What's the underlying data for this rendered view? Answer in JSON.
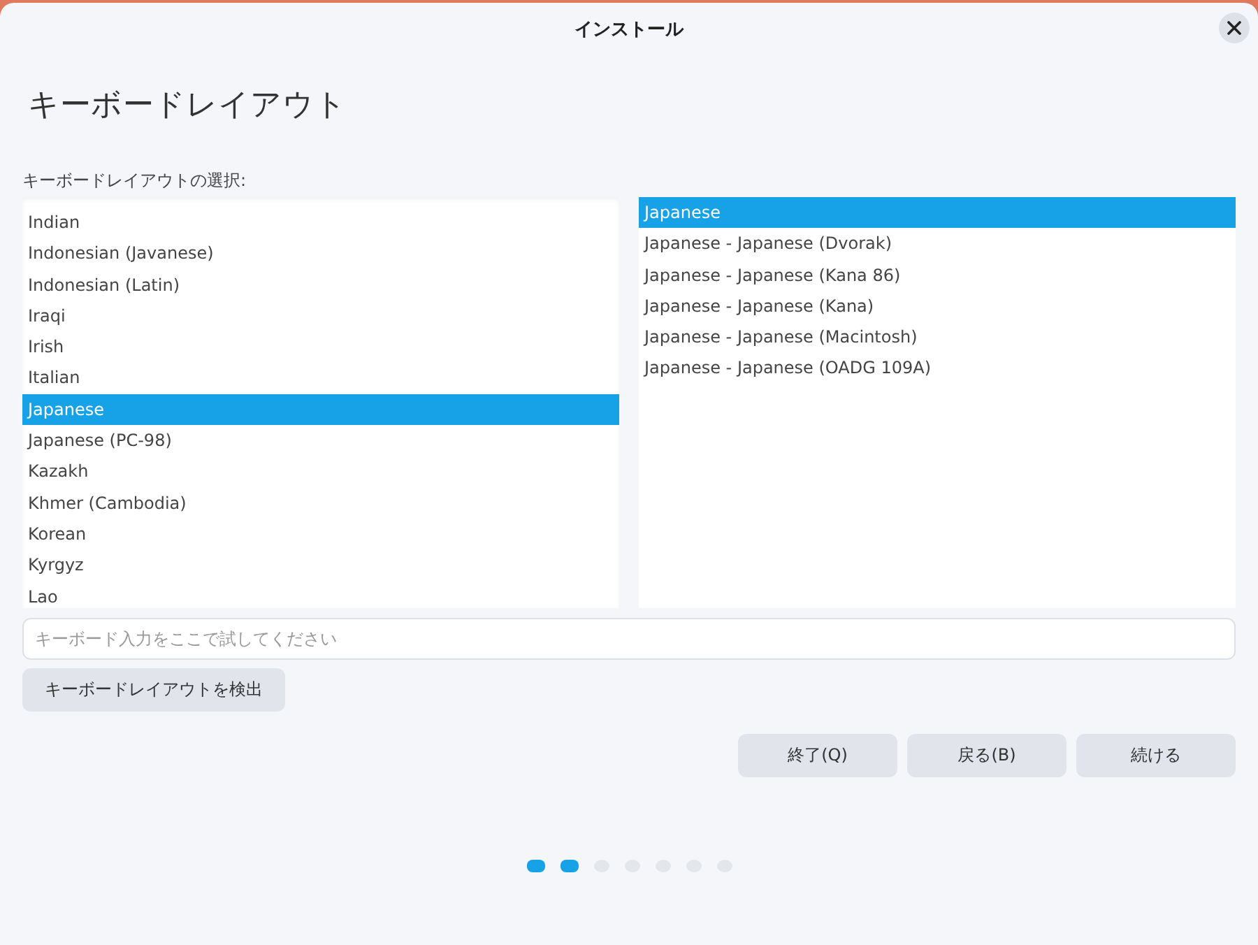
{
  "window": {
    "title": "インストール"
  },
  "heading": "キーボードレイアウト",
  "layout_label": "キーボードレイアウトの選択:",
  "layouts": [
    {
      "label": "Indian",
      "selected": false
    },
    {
      "label": "Indonesian (Javanese)",
      "selected": false
    },
    {
      "label": "Indonesian (Latin)",
      "selected": false
    },
    {
      "label": "Iraqi",
      "selected": false
    },
    {
      "label": "Irish",
      "selected": false
    },
    {
      "label": "Italian",
      "selected": false
    },
    {
      "label": "Japanese",
      "selected": true
    },
    {
      "label": "Japanese (PC-98)",
      "selected": false
    },
    {
      "label": "Kazakh",
      "selected": false
    },
    {
      "label": "Khmer (Cambodia)",
      "selected": false
    },
    {
      "label": "Korean",
      "selected": false
    },
    {
      "label": "Kyrgyz",
      "selected": false
    },
    {
      "label": "Lao",
      "selected": false
    }
  ],
  "variants": [
    {
      "label": "Japanese",
      "selected": true
    },
    {
      "label": "Japanese - Japanese (Dvorak)",
      "selected": false
    },
    {
      "label": "Japanese - Japanese (Kana 86)",
      "selected": false
    },
    {
      "label": "Japanese - Japanese (Kana)",
      "selected": false
    },
    {
      "label": "Japanese - Japanese (Macintosh)",
      "selected": false
    },
    {
      "label": "Japanese - Japanese (OADG 109A)",
      "selected": false
    }
  ],
  "test_field": {
    "placeholder": "キーボード入力をここで試してください"
  },
  "detect_button": "キーボードレイアウトを検出",
  "buttons": [
    "終了(Q)",
    "戻る(B)",
    "続ける"
  ],
  "steps": [
    {
      "done": true
    },
    {
      "done": true
    },
    {
      "done": false
    },
    {
      "done": false
    },
    {
      "done": false
    },
    {
      "done": false
    },
    {
      "done": false
    }
  ]
}
